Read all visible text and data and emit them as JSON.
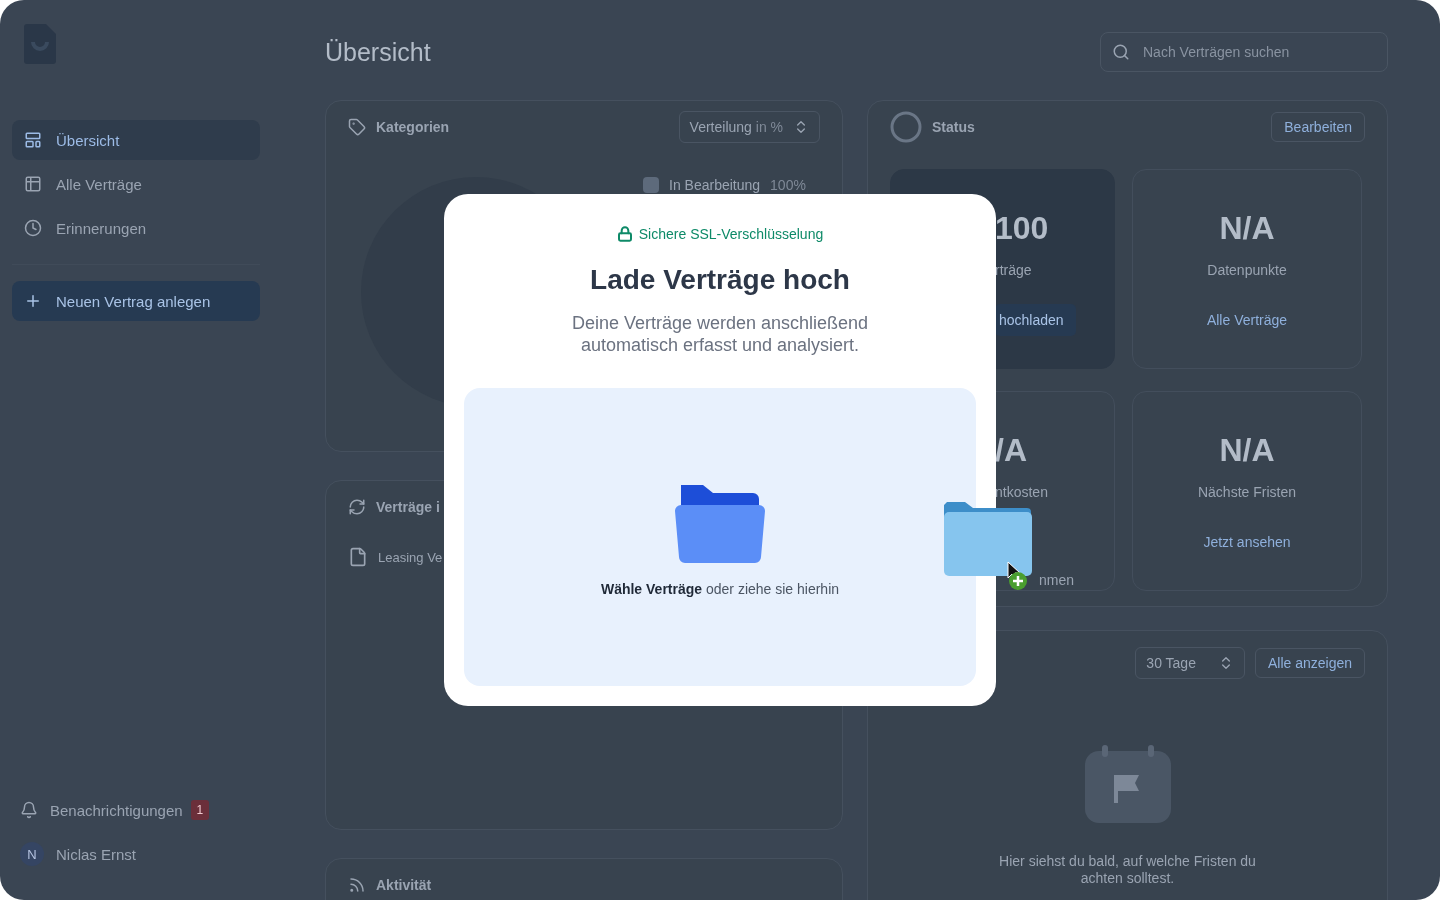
{
  "sidebar": {
    "nav_items": [
      {
        "label": "Übersicht",
        "selected": true
      },
      {
        "label": "Alle Verträge",
        "selected": false
      },
      {
        "label": "Erinnerungen",
        "selected": false
      }
    ],
    "new_contract_button": "Neuen Vertrag anlegen",
    "notifications": {
      "label": "Benachrichtigungen",
      "count": "1"
    },
    "user": {
      "initial": "N",
      "name": "Niclas Ernst"
    }
  },
  "header": {
    "title": "Übersicht",
    "search": {
      "placeholder": "Nach Verträgen suchen"
    }
  },
  "categories_card": {
    "title": "Kategorien",
    "select": {
      "label": "Verteilung",
      "suffix": "in %"
    },
    "legend": [
      {
        "label": "In Bearbeitung",
        "value": "100%"
      }
    ]
  },
  "contracts_card": {
    "title": "Verträge i",
    "items": [
      "Leasing Ve"
    ]
  },
  "activity_card": {
    "title": "Aktivität"
  },
  "status_card": {
    "title": "Status",
    "edit_button": "Bearbeiten",
    "stats": [
      {
        "value": "100",
        "label": "rträge",
        "action": "hochladen",
        "kind": "button",
        "highlighted": true
      },
      {
        "value": "N/A",
        "label": "Datenpunkte",
        "action": "Alle Verträge",
        "kind": "link",
        "highlighted": false
      },
      {
        "value": "/A",
        "label": "ntkosten",
        "action": "nmen",
        "kind": "text",
        "highlighted": false
      },
      {
        "value": "N/A",
        "label": "Nächste Fristen",
        "action": "Jetzt ansehen",
        "kind": "link",
        "highlighted": false
      }
    ]
  },
  "deadlines_card": {
    "range_select": "30 Tage",
    "show_all_button": "Alle anzeigen",
    "empty_text": "Hier siehst du bald, auf welche Fristen du achten solltest."
  },
  "upload_dialog": {
    "security_note": "Sichere SSL-Verschlüsselung",
    "title": "Lade Verträge hoch",
    "subtitle": "Deine Verträge werden anschließend automatisch erfasst und analysiert.",
    "dropzone_text": "**Wähle Verträge** oder ziehe sie hierhin"
  }
}
